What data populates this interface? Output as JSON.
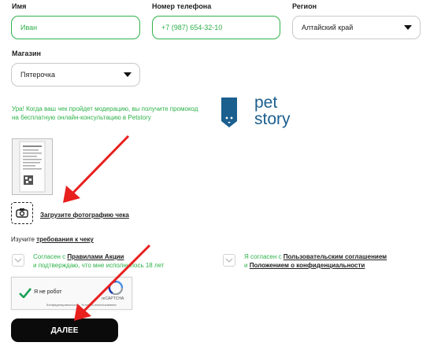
{
  "form": {
    "name_label": "Имя",
    "name_value": "Иван",
    "phone_label": "Номер телефона",
    "phone_value": "+7 (987) 654-32-10",
    "region_label": "Регион",
    "region_value": "Алтайский край",
    "store_label": "Магазин",
    "store_value": "Пятерочка"
  },
  "moderation_note_line1": "Ура! Когда ваш чек пройдет модерацию, вы получите промокод",
  "moderation_note_line2": "на бесплатную онлайн-консультацию в Petstory",
  "logo": {
    "line1": "pet",
    "line2": "story",
    "color": "#1b5f8f"
  },
  "upload": {
    "link_text": "Загрузите фотографию чека",
    "icon": "camera-icon"
  },
  "requirements": {
    "prefix": "Изучите ",
    "link_text": "требования к чеку"
  },
  "consent_rules": {
    "part1": "Согласен с ",
    "link1": "Правилами Акции",
    "part2": "и подтверждаю, что мне исполнилось 18 лет"
  },
  "consent_privacy": {
    "part1": "Я согласен с ",
    "link1": "Пользовательским соглашением",
    "part2": "и ",
    "link2": "Положением о конфиденциальности"
  },
  "captcha": {
    "label": "Я не робот",
    "brand": "reCAPTCHA",
    "footer": "Конфиденциальность - Условия использования"
  },
  "submit_label": "ДАЛЕЕ",
  "colors": {
    "accent": "#2eb24a",
    "arrow": "#e8201e",
    "button": "#0b0b0b"
  }
}
